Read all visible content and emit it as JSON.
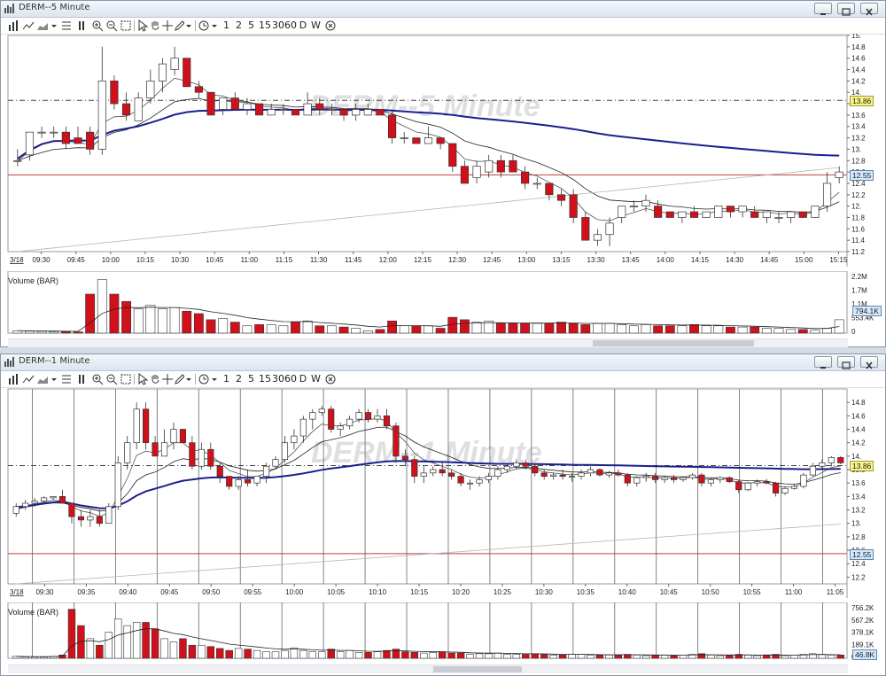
{
  "colors": {
    "up_fill": "#ffffff",
    "down_fill": "#d0111b",
    "candle_line": "#333333",
    "ema_fast": "#555555",
    "ema_slow": "#222222",
    "vwap": "#1b1f8f",
    "sma_long": "#b5b5b5",
    "support_line": "#b84040",
    "axis_bg": "#ffffff",
    "label_blue": "#d6e8f7",
    "label_yellow": "#f6f38a"
  },
  "toolbar": {
    "items": [
      "1",
      "2",
      "5",
      "15",
      "30",
      "60",
      "D",
      "W"
    ]
  },
  "windows": [
    {
      "title": "DERM--5 Minute",
      "watermark": "DERM--5 Minute",
      "date_label": "3/18",
      "price_axis": [
        "15.",
        "14.8",
        "14.6",
        "14.4",
        "14.2",
        "14.",
        "13.8",
        "13.6",
        "13.4",
        "13.2",
        "13.",
        "12.8",
        "12.6",
        "12.4",
        "12.2",
        "12.",
        "11.8",
        "11.6",
        "11.4",
        "11.2"
      ],
      "time_axis": [
        "09:30",
        "09:45",
        "10:00",
        "10:15",
        "10:30",
        "10:45",
        "11:00",
        "11:15",
        "11:30",
        "11:45",
        "12:00",
        "12:15",
        "12:30",
        "12:45",
        "13:00",
        "13:15",
        "13:30",
        "13:45",
        "14:00",
        "14:15",
        "14:30",
        "14:45",
        "15:00",
        "15:15"
      ],
      "price_labels": [
        {
          "text": "13.86",
          "value": 13.86,
          "style": "yellow"
        },
        {
          "text": "12.55",
          "value": 12.55,
          "style": "blue"
        }
      ],
      "volume_title": "Volume (BAR)",
      "volume_axis": [
        "2.2M",
        "1.7M",
        "1.1M",
        "553.4K",
        "0"
      ],
      "volume_label": "794.1K"
    },
    {
      "title": "DERM--1 Minute",
      "watermark": "DERM--1 Minute",
      "date_label": "3/18",
      "price_axis": [
        "14.8",
        "14.6",
        "14.4",
        "14.2",
        "14.",
        "13.8",
        "13.6",
        "13.4",
        "13.2",
        "13.",
        "12.8",
        "12.6",
        "12.4",
        "12.2"
      ],
      "time_axis": [
        "09:30",
        "09:35",
        "09:40",
        "09:45",
        "09:50",
        "09:55",
        "10:00",
        "10:05",
        "10:10",
        "10:15",
        "10:20",
        "10:25",
        "10:30",
        "10:35",
        "10:40",
        "10:45",
        "10:50",
        "10:55",
        "11:00",
        "11:05"
      ],
      "price_labels": [
        {
          "text": "13.86",
          "value": 13.86,
          "style": "yellow"
        },
        {
          "text": "12.55",
          "value": 12.55,
          "style": "blue"
        }
      ],
      "volume_title": "Volume (BAR)",
      "volume_axis": [
        "756.2K",
        "567.2K",
        "378.1K",
        "189.1K",
        "0"
      ],
      "volume_label": "46.8K"
    }
  ],
  "chart_data": [
    {
      "type": "candlestick",
      "title": "DERM--5 Minute",
      "ylim": [
        11.2,
        15.0
      ],
      "reference_lines": [
        13.86,
        12.55
      ],
      "candles": [
        [
          12.8,
          13.0,
          12.7,
          12.8
        ],
        [
          12.9,
          13.3,
          12.8,
          13.3
        ],
        [
          13.3,
          13.4,
          13.2,
          13.3
        ],
        [
          13.3,
          13.4,
          13.2,
          13.3
        ],
        [
          13.3,
          13.4,
          13.0,
          13.1
        ],
        [
          13.2,
          13.4,
          13.1,
          13.1
        ],
        [
          13.3,
          13.4,
          12.9,
          13.0
        ],
        [
          13.0,
          14.8,
          12.9,
          14.2
        ],
        [
          14.2,
          14.3,
          13.7,
          13.8
        ],
        [
          13.8,
          14.0,
          13.5,
          13.6
        ],
        [
          13.5,
          14.0,
          13.5,
          13.9
        ],
        [
          13.9,
          14.4,
          13.8,
          14.2
        ],
        [
          14.2,
          14.6,
          14.0,
          14.5
        ],
        [
          14.4,
          14.8,
          14.3,
          14.6
        ],
        [
          14.6,
          14.6,
          14.1,
          14.1
        ],
        [
          14.1,
          14.2,
          13.9,
          14.0
        ],
        [
          14.0,
          14.0,
          13.6,
          13.6
        ],
        [
          13.7,
          13.9,
          13.6,
          13.9
        ],
        [
          13.9,
          14.0,
          13.7,
          13.7
        ],
        [
          13.7,
          13.9,
          13.6,
          13.8
        ],
        [
          13.8,
          13.8,
          13.6,
          13.6
        ],
        [
          13.6,
          13.8,
          13.6,
          13.7
        ],
        [
          13.7,
          13.8,
          13.6,
          13.7
        ],
        [
          13.7,
          13.7,
          13.6,
          13.6
        ],
        [
          13.6,
          14.0,
          13.6,
          13.8
        ],
        [
          13.8,
          13.9,
          13.6,
          13.7
        ],
        [
          13.7,
          13.8,
          13.6,
          13.7
        ],
        [
          13.7,
          13.7,
          13.5,
          13.6
        ],
        [
          13.6,
          13.8,
          13.5,
          13.7
        ],
        [
          13.6,
          13.8,
          13.6,
          13.7
        ],
        [
          13.7,
          13.7,
          13.6,
          13.6
        ],
        [
          13.6,
          13.7,
          13.1,
          13.2
        ],
        [
          13.2,
          13.3,
          13.1,
          13.2
        ],
        [
          13.2,
          13.2,
          13.1,
          13.1
        ],
        [
          13.1,
          13.4,
          13.1,
          13.2
        ],
        [
          13.2,
          13.2,
          13.0,
          13.1
        ],
        [
          13.1,
          13.1,
          12.6,
          12.7
        ],
        [
          12.7,
          12.8,
          12.4,
          12.4
        ],
        [
          12.5,
          12.8,
          12.4,
          12.7
        ],
        [
          12.6,
          12.9,
          12.5,
          12.8
        ],
        [
          12.8,
          12.9,
          12.5,
          12.6
        ],
        [
          12.8,
          12.9,
          12.6,
          12.6
        ],
        [
          12.6,
          12.7,
          12.3,
          12.4
        ],
        [
          12.4,
          12.5,
          12.3,
          12.4
        ],
        [
          12.4,
          12.4,
          12.1,
          12.2
        ],
        [
          12.2,
          12.3,
          12.0,
          12.1
        ],
        [
          12.2,
          12.3,
          11.7,
          11.8
        ],
        [
          11.8,
          11.9,
          11.4,
          11.4
        ],
        [
          11.4,
          11.6,
          11.3,
          11.5
        ],
        [
          11.5,
          11.8,
          11.3,
          11.7
        ],
        [
          11.8,
          12.0,
          11.7,
          12.0
        ],
        [
          12.0,
          12.1,
          11.9,
          12.0
        ],
        [
          12.0,
          12.2,
          11.9,
          12.1
        ],
        [
          12.0,
          12.1,
          11.8,
          11.8
        ],
        [
          11.9,
          11.9,
          11.8,
          11.8
        ],
        [
          11.8,
          11.9,
          11.7,
          11.9
        ],
        [
          11.9,
          12.0,
          11.8,
          11.8
        ],
        [
          11.8,
          11.9,
          11.8,
          11.9
        ],
        [
          11.8,
          12.0,
          11.8,
          12.0
        ],
        [
          12.0,
          12.0,
          11.8,
          11.9
        ],
        [
          11.9,
          12.0,
          11.8,
          12.0
        ],
        [
          11.9,
          12.0,
          11.8,
          11.8
        ],
        [
          11.8,
          11.9,
          11.7,
          11.9
        ],
        [
          11.8,
          11.9,
          11.7,
          11.8
        ],
        [
          11.8,
          11.9,
          11.7,
          11.9
        ],
        [
          11.9,
          11.9,
          11.8,
          11.8
        ],
        [
          11.8,
          12.0,
          11.8,
          12.0
        ],
        [
          12.0,
          12.6,
          11.9,
          12.4
        ],
        [
          12.5,
          12.7,
          12.4,
          12.6
        ]
      ],
      "volume": [
        0.1,
        0.08,
        0.07,
        0.06,
        0.06,
        0.05,
        1.6,
        2.2,
        1.6,
        1.3,
        1.0,
        1.15,
        1.0,
        1.05,
        0.9,
        0.8,
        0.55,
        0.6,
        0.45,
        0.3,
        0.35,
        0.35,
        0.3,
        0.45,
        0.5,
        0.3,
        0.3,
        0.25,
        0.2,
        0.1,
        0.15,
        0.5,
        0.3,
        0.3,
        0.3,
        0.2,
        0.65,
        0.55,
        0.45,
        0.5,
        0.4,
        0.4,
        0.4,
        0.4,
        0.4,
        0.45,
        0.4,
        0.35,
        0.4,
        0.4,
        0.35,
        0.3,
        0.35,
        0.3,
        0.3,
        0.3,
        0.35,
        0.3,
        0.3,
        0.25,
        0.25,
        0.25,
        0.2,
        0.2,
        0.15,
        0.15,
        0.12,
        0.2,
        0.55
      ]
    },
    {
      "type": "candlestick",
      "title": "DERM--1 Minute",
      "ylim": [
        12.1,
        15.0
      ],
      "reference_lines": [
        13.86,
        12.55
      ],
      "candles": [
        [
          13.15,
          13.3,
          13.1,
          13.25
        ],
        [
          13.25,
          13.35,
          13.2,
          13.3
        ],
        [
          13.3,
          13.38,
          13.25,
          13.33
        ],
        [
          13.33,
          13.4,
          13.3,
          13.38
        ],
        [
          13.38,
          13.4,
          13.35,
          13.4
        ],
        [
          13.4,
          13.5,
          13.3,
          13.3
        ],
        [
          13.3,
          13.3,
          13.0,
          13.1
        ],
        [
          13.1,
          13.2,
          12.95,
          13.05
        ],
        [
          13.05,
          13.2,
          12.95,
          13.1
        ],
        [
          13.1,
          13.2,
          12.95,
          13.0
        ],
        [
          13.0,
          13.3,
          13.0,
          13.25
        ],
        [
          13.25,
          14.0,
          13.2,
          13.9
        ],
        [
          13.9,
          14.3,
          13.8,
          14.2
        ],
        [
          14.2,
          14.8,
          14.1,
          14.7
        ],
        [
          14.7,
          14.8,
          14.1,
          14.2
        ],
        [
          14.2,
          14.3,
          14.0,
          14.0
        ],
        [
          14.0,
          14.4,
          14.0,
          14.2
        ],
        [
          14.2,
          14.5,
          14.1,
          14.4
        ],
        [
          14.4,
          14.4,
          14.2,
          14.2
        ],
        [
          14.2,
          14.3,
          13.8,
          13.85
        ],
        [
          13.85,
          14.2,
          13.8,
          14.1
        ],
        [
          14.1,
          14.2,
          13.8,
          13.85
        ],
        [
          13.85,
          13.9,
          13.6,
          13.7
        ],
        [
          13.7,
          13.7,
          13.5,
          13.55
        ],
        [
          13.55,
          13.7,
          13.5,
          13.65
        ],
        [
          13.65,
          13.8,
          13.55,
          13.6
        ],
        [
          13.6,
          13.7,
          13.55,
          13.7
        ],
        [
          13.7,
          13.9,
          13.6,
          13.85
        ],
        [
          13.85,
          14.0,
          13.8,
          13.95
        ],
        [
          13.95,
          14.3,
          13.9,
          14.2
        ],
        [
          14.2,
          14.4,
          14.1,
          14.3
        ],
        [
          14.3,
          14.6,
          14.2,
          14.55
        ],
        [
          14.55,
          14.7,
          14.4,
          14.65
        ],
        [
          14.65,
          14.75,
          14.6,
          14.7
        ],
        [
          14.7,
          14.75,
          14.35,
          14.4
        ],
        [
          14.4,
          14.5,
          14.3,
          14.45
        ],
        [
          14.45,
          14.6,
          14.4,
          14.55
        ],
        [
          14.55,
          14.7,
          14.5,
          14.65
        ],
        [
          14.65,
          14.7,
          14.5,
          14.55
        ],
        [
          14.55,
          14.7,
          14.5,
          14.6
        ],
        [
          14.6,
          14.7,
          14.4,
          14.45
        ],
        [
          14.45,
          14.5,
          13.9,
          14.0
        ],
        [
          14.0,
          14.1,
          13.85,
          13.95
        ],
        [
          13.95,
          14.0,
          13.6,
          13.7
        ],
        [
          13.7,
          13.85,
          13.6,
          13.75
        ],
        [
          13.75,
          13.85,
          13.7,
          13.8
        ],
        [
          13.8,
          13.9,
          13.7,
          13.75
        ],
        [
          13.75,
          13.8,
          13.65,
          13.7
        ],
        [
          13.7,
          13.75,
          13.55,
          13.6
        ],
        [
          13.6,
          13.65,
          13.5,
          13.6
        ],
        [
          13.6,
          13.7,
          13.55,
          13.65
        ],
        [
          13.65,
          13.75,
          13.6,
          13.7
        ],
        [
          13.7,
          13.85,
          13.65,
          13.8
        ],
        [
          13.8,
          13.9,
          13.75,
          13.85
        ],
        [
          13.85,
          13.95,
          13.8,
          13.9
        ],
        [
          13.9,
          13.95,
          13.8,
          13.85
        ],
        [
          13.85,
          13.9,
          13.7,
          13.75
        ],
        [
          13.75,
          13.8,
          13.65,
          13.7
        ],
        [
          13.7,
          13.75,
          13.65,
          13.72
        ],
        [
          13.72,
          13.8,
          13.65,
          13.7
        ],
        [
          13.7,
          13.75,
          13.62,
          13.7
        ],
        [
          13.7,
          13.8,
          13.65,
          13.75
        ],
        [
          13.75,
          13.85,
          13.7,
          13.8
        ],
        [
          13.8,
          13.82,
          13.7,
          13.72
        ],
        [
          13.72,
          13.78,
          13.68,
          13.75
        ],
        [
          13.75,
          13.8,
          13.7,
          13.72
        ],
        [
          13.72,
          13.75,
          13.55,
          13.6
        ],
        [
          13.6,
          13.7,
          13.55,
          13.68
        ],
        [
          13.68,
          13.75,
          13.62,
          13.7
        ],
        [
          13.7,
          13.75,
          13.6,
          13.65
        ],
        [
          13.65,
          13.7,
          13.6,
          13.68
        ],
        [
          13.68,
          13.72,
          13.6,
          13.65
        ],
        [
          13.65,
          13.7,
          13.62,
          13.68
        ],
        [
          13.68,
          13.75,
          13.65,
          13.72
        ],
        [
          13.72,
          13.75,
          13.55,
          13.6
        ],
        [
          13.6,
          13.68,
          13.55,
          13.65
        ],
        [
          13.65,
          13.7,
          13.6,
          13.68
        ],
        [
          13.68,
          13.7,
          13.6,
          13.62
        ],
        [
          13.62,
          13.65,
          13.45,
          13.5
        ],
        [
          13.5,
          13.62,
          13.48,
          13.6
        ],
        [
          13.6,
          13.65,
          13.55,
          13.62
        ],
        [
          13.62,
          13.66,
          13.58,
          13.6
        ],
        [
          13.6,
          13.62,
          13.4,
          13.45
        ],
        [
          13.45,
          13.55,
          13.42,
          13.52
        ],
        [
          13.52,
          13.58,
          13.5,
          13.55
        ],
        [
          13.55,
          13.75,
          13.52,
          13.72
        ],
        [
          13.72,
          13.9,
          13.7,
          13.85
        ],
        [
          13.85,
          13.95,
          13.8,
          13.9
        ],
        [
          13.9,
          14.0,
          13.85,
          13.98
        ],
        [
          13.98,
          14.0,
          13.88,
          13.9
        ]
      ],
      "volume": [
        0.03,
        0.02,
        0.02,
        0.02,
        0.03,
        0.05,
        0.75,
        0.5,
        0.3,
        0.2,
        0.4,
        0.6,
        0.5,
        0.55,
        0.55,
        0.45,
        0.3,
        0.25,
        0.3,
        0.2,
        0.2,
        0.18,
        0.15,
        0.12,
        0.15,
        0.14,
        0.12,
        0.1,
        0.1,
        0.12,
        0.16,
        0.12,
        0.1,
        0.1,
        0.14,
        0.1,
        0.12,
        0.09,
        0.09,
        0.1,
        0.12,
        0.14,
        0.1,
        0.09,
        0.08,
        0.09,
        0.1,
        0.08,
        0.08,
        0.06,
        0.07,
        0.07,
        0.08,
        0.06,
        0.06,
        0.06,
        0.07,
        0.06,
        0.05,
        0.05,
        0.06,
        0.06,
        0.05,
        0.05,
        0.05,
        0.05,
        0.06,
        0.05,
        0.04,
        0.05,
        0.05,
        0.04,
        0.05,
        0.06,
        0.07,
        0.05,
        0.04,
        0.05,
        0.06,
        0.05,
        0.04,
        0.05,
        0.06,
        0.04,
        0.05,
        0.06,
        0.07,
        0.06,
        0.05,
        0.05
      ]
    }
  ]
}
